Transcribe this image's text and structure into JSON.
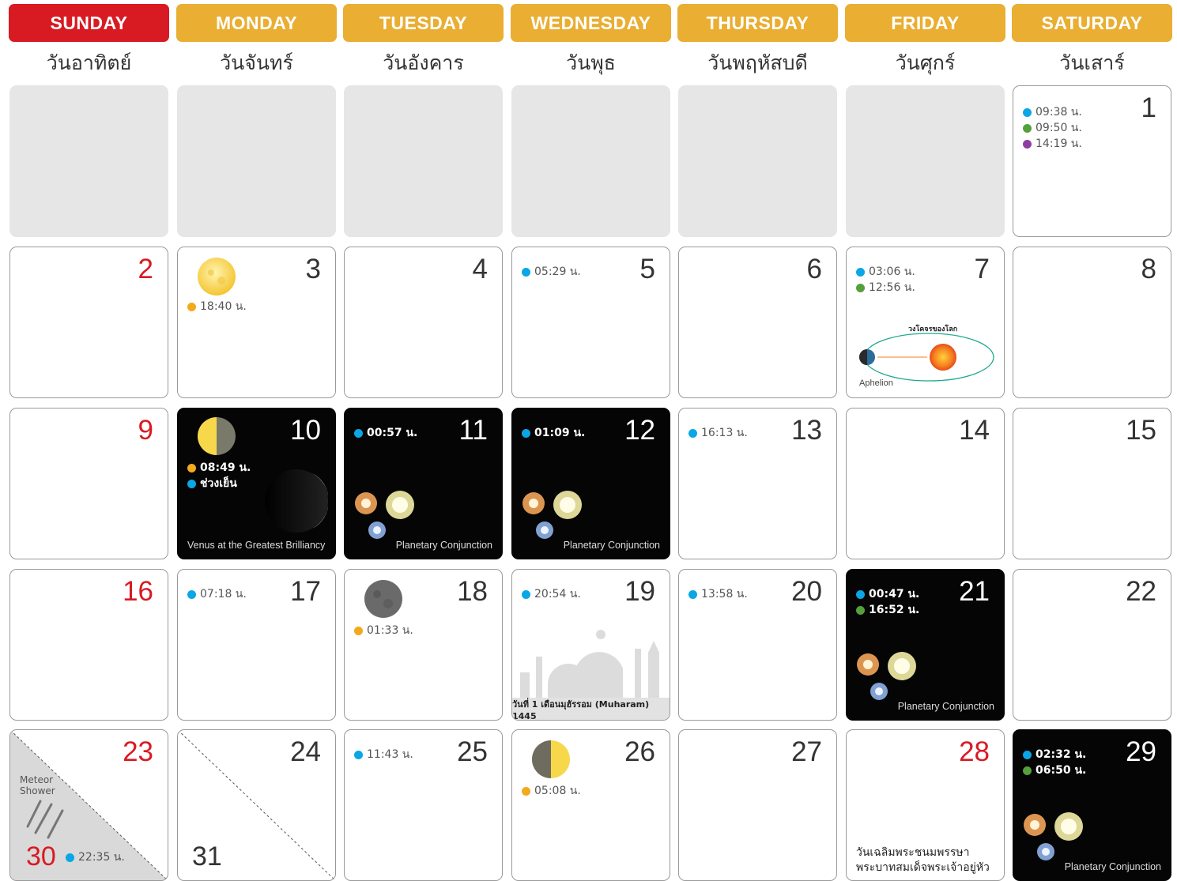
{
  "days": [
    {
      "en": "SUNDAY",
      "th": "วันอาทิตย์"
    },
    {
      "en": "MONDAY",
      "th": "วันจันทร์"
    },
    {
      "en": "TUESDAY",
      "th": "วันอังคาร"
    },
    {
      "en": "WEDNESDAY",
      "th": "วันพุธ"
    },
    {
      "en": "THURSDAY",
      "th": "วันพฤหัสบดี"
    },
    {
      "en": "FRIDAY",
      "th": "วันศุกร์"
    },
    {
      "en": "SATURDAY",
      "th": "วันเสาร์"
    }
  ],
  "colors": {
    "sunday": "#d81a23",
    "weekday": "#e9ae32",
    "blue": "#0aa6e6",
    "green": "#56a03c",
    "purple": "#8f3e9e",
    "orange": "#f2a91c"
  },
  "cells": {
    "d1": {
      "num": "1",
      "ev": [
        "09:38 น.",
        "09:50 น.",
        "14:19 น."
      ]
    },
    "d2": {
      "num": "2"
    },
    "d3": {
      "num": "3",
      "ev": [
        "18:40 น."
      ]
    },
    "d4": {
      "num": "4"
    },
    "d5": {
      "num": "5",
      "ev": [
        "05:29 น."
      ]
    },
    "d6": {
      "num": "6"
    },
    "d7": {
      "num": "7",
      "ev": [
        "03:06 น.",
        "12:56 น."
      ],
      "orbit_label": "วงโคจรของโลก",
      "caption": "Aphelion"
    },
    "d8": {
      "num": "8"
    },
    "d9": {
      "num": "9"
    },
    "d10": {
      "num": "10",
      "ev": [
        "08:49 น.",
        "ช่วงเย็น"
      ],
      "caption": "Venus at the Greatest Brilliancy"
    },
    "d11": {
      "num": "11",
      "ev": [
        "00:57 น."
      ],
      "caption": "Planetary Conjunction"
    },
    "d12": {
      "num": "12",
      "ev": [
        "01:09 น."
      ],
      "caption": "Planetary Conjunction"
    },
    "d13": {
      "num": "13",
      "ev": [
        "16:13 น."
      ]
    },
    "d14": {
      "num": "14"
    },
    "d15": {
      "num": "15"
    },
    "d16": {
      "num": "16"
    },
    "d17": {
      "num": "17",
      "ev": [
        "07:18 น."
      ]
    },
    "d18": {
      "num": "18",
      "ev": [
        "01:33 น."
      ]
    },
    "d19": {
      "num": "19",
      "ev": [
        "20:54 น."
      ],
      "caption": "วันที่ 1 เดือนมุฮัรรอม (Muharam) 1445"
    },
    "d20": {
      "num": "20",
      "ev": [
        "13:58 น."
      ]
    },
    "d21": {
      "num": "21",
      "ev": [
        "00:47 น.",
        "16:52 น."
      ],
      "caption": "Planetary Conjunction"
    },
    "d22": {
      "num": "22"
    },
    "d23": {
      "num": "23",
      "num2": "30",
      "ev": [
        "22:35 น."
      ],
      "caption": "Meteor Shower"
    },
    "d24": {
      "num": "24",
      "num2": "31"
    },
    "d25": {
      "num": "25",
      "ev": [
        "11:43 น."
      ]
    },
    "d26": {
      "num": "26",
      "ev": [
        "05:08 น."
      ]
    },
    "d27": {
      "num": "27"
    },
    "d28": {
      "num": "28",
      "note": [
        "วันเฉลิมพระชนมพรรษา",
        "พระบาทสมเด็จพระเจ้าอยู่หัว"
      ]
    },
    "d29": {
      "num": "29",
      "ev": [
        "02:32 น.",
        "06:50 น."
      ],
      "caption": "Planetary Conjunction"
    }
  }
}
